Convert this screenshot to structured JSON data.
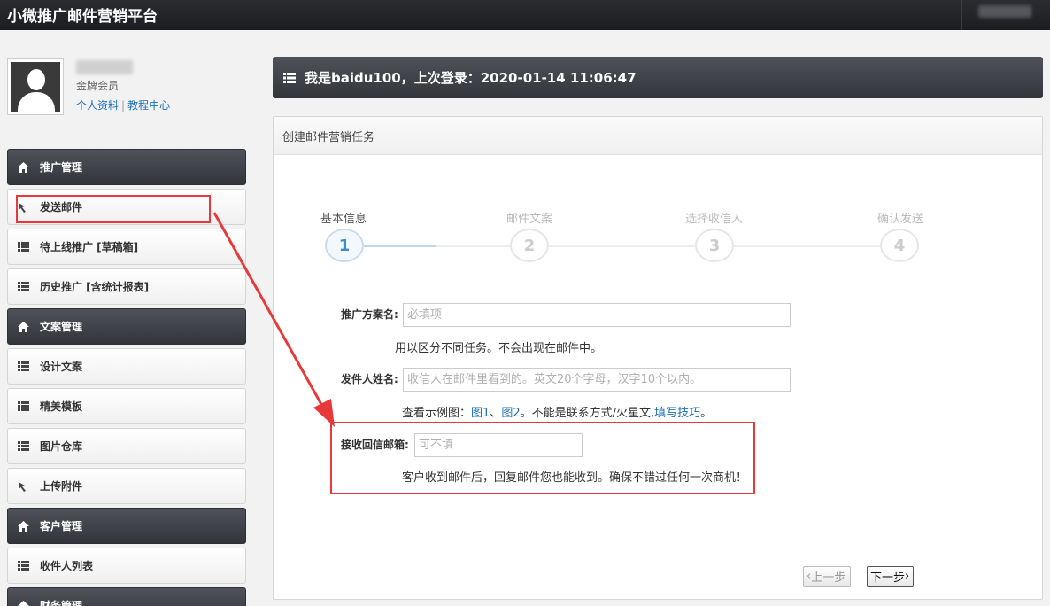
{
  "app": {
    "title": "小微推广邮件营销平台"
  },
  "profile": {
    "level": "金牌会员",
    "link_profile": "个人资料",
    "separator": "|",
    "link_tutorial": "教程中心"
  },
  "sidebar": {
    "items": [
      {
        "label": "推广管理",
        "type": "header",
        "icon": "home-icon"
      },
      {
        "label": "发送邮件",
        "type": "item",
        "icon": "send-icon"
      },
      {
        "label": "待上线推广 [草稿箱]",
        "type": "item",
        "icon": "list-icon"
      },
      {
        "label": "历史推广 [含统计报表]",
        "type": "item",
        "icon": "list-icon"
      },
      {
        "label": "文案管理",
        "type": "header",
        "icon": "home-icon"
      },
      {
        "label": "设计文案",
        "type": "item",
        "icon": "list-icon"
      },
      {
        "label": "精美模板",
        "type": "item",
        "icon": "list-icon"
      },
      {
        "label": "图片仓库",
        "type": "item",
        "icon": "list-icon"
      },
      {
        "label": "上传附件",
        "type": "item",
        "icon": "send-icon"
      },
      {
        "label": "客户管理",
        "type": "header",
        "icon": "home-icon"
      },
      {
        "label": "收件人列表",
        "type": "item",
        "icon": "list-icon"
      },
      {
        "label": "财务管理",
        "type": "header",
        "icon": "home-icon"
      }
    ]
  },
  "welcome": {
    "text": "我是baidu100，上次登录：2020-01-14 11:06:47"
  },
  "panel": {
    "title": "创建邮件营销任务"
  },
  "steps": [
    {
      "label": "基本信息",
      "number": "1",
      "active": true
    },
    {
      "label": "邮件文案",
      "number": "2",
      "active": false
    },
    {
      "label": "选择收信人",
      "number": "3",
      "active": false
    },
    {
      "label": "确认发送",
      "number": "4",
      "active": false
    }
  ],
  "form": {
    "campaign_name": {
      "label": "推广方案名:",
      "placeholder": "必填项",
      "help": "用以区分不同任务。不会出现在邮件中。"
    },
    "sender_name": {
      "label": "发件人姓名:",
      "placeholder": "收信人在邮件里看到的。英文20个字母，汉字10个以内。",
      "help_prefix": "查看示例图：",
      "help_link1": "图1",
      "help_sep": "、",
      "help_link2": "图2",
      "help_middle": "。不能是联系方式/火星文,",
      "help_link3": "填写技巧",
      "help_suffix": "。"
    },
    "reply_email": {
      "label": "接收回信邮箱:",
      "placeholder": "可不填",
      "help": "客户收到邮件后，回复邮件您也能收到。确保不错过任何一次商机！"
    }
  },
  "buttons": {
    "prev": "上一步",
    "next": "下一步"
  },
  "colors": {
    "annotation_red": "#e8393a",
    "link_blue": "#1a6fb5",
    "header_dark": "#33353b"
  }
}
